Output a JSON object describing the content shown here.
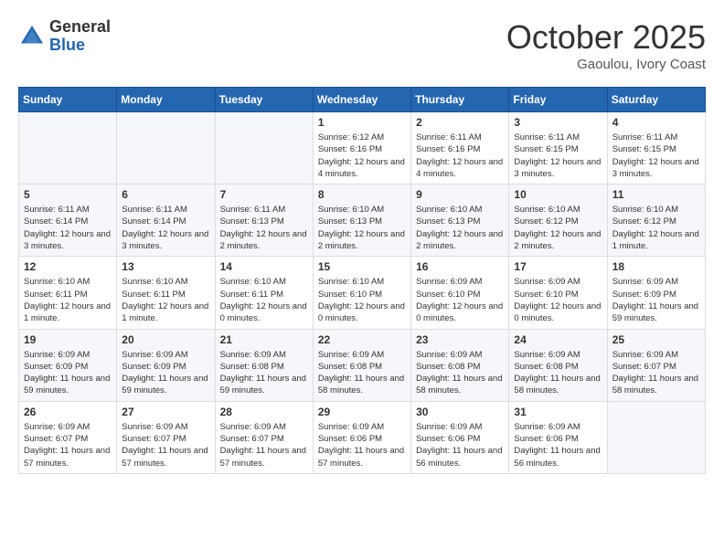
{
  "header": {
    "logo": {
      "general": "General",
      "blue": "Blue"
    },
    "title": "October 2025",
    "location": "Gaoulou, Ivory Coast"
  },
  "weekdays": [
    "Sunday",
    "Monday",
    "Tuesday",
    "Wednesday",
    "Thursday",
    "Friday",
    "Saturday"
  ],
  "weeks": [
    [
      {
        "day": "",
        "info": ""
      },
      {
        "day": "",
        "info": ""
      },
      {
        "day": "",
        "info": ""
      },
      {
        "day": "1",
        "info": "Sunrise: 6:12 AM\nSunset: 6:16 PM\nDaylight: 12 hours\nand 4 minutes."
      },
      {
        "day": "2",
        "info": "Sunrise: 6:11 AM\nSunset: 6:16 PM\nDaylight: 12 hours\nand 4 minutes."
      },
      {
        "day": "3",
        "info": "Sunrise: 6:11 AM\nSunset: 6:15 PM\nDaylight: 12 hours\nand 3 minutes."
      },
      {
        "day": "4",
        "info": "Sunrise: 6:11 AM\nSunset: 6:15 PM\nDaylight: 12 hours\nand 3 minutes."
      }
    ],
    [
      {
        "day": "5",
        "info": "Sunrise: 6:11 AM\nSunset: 6:14 PM\nDaylight: 12 hours\nand 3 minutes."
      },
      {
        "day": "6",
        "info": "Sunrise: 6:11 AM\nSunset: 6:14 PM\nDaylight: 12 hours\nand 3 minutes."
      },
      {
        "day": "7",
        "info": "Sunrise: 6:11 AM\nSunset: 6:13 PM\nDaylight: 12 hours\nand 2 minutes."
      },
      {
        "day": "8",
        "info": "Sunrise: 6:10 AM\nSunset: 6:13 PM\nDaylight: 12 hours\nand 2 minutes."
      },
      {
        "day": "9",
        "info": "Sunrise: 6:10 AM\nSunset: 6:13 PM\nDaylight: 12 hours\nand 2 minutes."
      },
      {
        "day": "10",
        "info": "Sunrise: 6:10 AM\nSunset: 6:12 PM\nDaylight: 12 hours\nand 2 minutes."
      },
      {
        "day": "11",
        "info": "Sunrise: 6:10 AM\nSunset: 6:12 PM\nDaylight: 12 hours\nand 1 minute."
      }
    ],
    [
      {
        "day": "12",
        "info": "Sunrise: 6:10 AM\nSunset: 6:11 PM\nDaylight: 12 hours\nand 1 minute."
      },
      {
        "day": "13",
        "info": "Sunrise: 6:10 AM\nSunset: 6:11 PM\nDaylight: 12 hours\nand 1 minute."
      },
      {
        "day": "14",
        "info": "Sunrise: 6:10 AM\nSunset: 6:11 PM\nDaylight: 12 hours\nand 0 minutes."
      },
      {
        "day": "15",
        "info": "Sunrise: 6:10 AM\nSunset: 6:10 PM\nDaylight: 12 hours\nand 0 minutes."
      },
      {
        "day": "16",
        "info": "Sunrise: 6:09 AM\nSunset: 6:10 PM\nDaylight: 12 hours\nand 0 minutes."
      },
      {
        "day": "17",
        "info": "Sunrise: 6:09 AM\nSunset: 6:10 PM\nDaylight: 12 hours\nand 0 minutes."
      },
      {
        "day": "18",
        "info": "Sunrise: 6:09 AM\nSunset: 6:09 PM\nDaylight: 11 hours\nand 59 minutes."
      }
    ],
    [
      {
        "day": "19",
        "info": "Sunrise: 6:09 AM\nSunset: 6:09 PM\nDaylight: 11 hours\nand 59 minutes."
      },
      {
        "day": "20",
        "info": "Sunrise: 6:09 AM\nSunset: 6:09 PM\nDaylight: 11 hours\nand 59 minutes."
      },
      {
        "day": "21",
        "info": "Sunrise: 6:09 AM\nSunset: 6:08 PM\nDaylight: 11 hours\nand 59 minutes."
      },
      {
        "day": "22",
        "info": "Sunrise: 6:09 AM\nSunset: 6:08 PM\nDaylight: 11 hours\nand 58 minutes."
      },
      {
        "day": "23",
        "info": "Sunrise: 6:09 AM\nSunset: 6:08 PM\nDaylight: 11 hours\nand 58 minutes."
      },
      {
        "day": "24",
        "info": "Sunrise: 6:09 AM\nSunset: 6:08 PM\nDaylight: 11 hours\nand 58 minutes."
      },
      {
        "day": "25",
        "info": "Sunrise: 6:09 AM\nSunset: 6:07 PM\nDaylight: 11 hours\nand 58 minutes."
      }
    ],
    [
      {
        "day": "26",
        "info": "Sunrise: 6:09 AM\nSunset: 6:07 PM\nDaylight: 11 hours\nand 57 minutes."
      },
      {
        "day": "27",
        "info": "Sunrise: 6:09 AM\nSunset: 6:07 PM\nDaylight: 11 hours\nand 57 minutes."
      },
      {
        "day": "28",
        "info": "Sunrise: 6:09 AM\nSunset: 6:07 PM\nDaylight: 11 hours\nand 57 minutes."
      },
      {
        "day": "29",
        "info": "Sunrise: 6:09 AM\nSunset: 6:06 PM\nDaylight: 11 hours\nand 57 minutes."
      },
      {
        "day": "30",
        "info": "Sunrise: 6:09 AM\nSunset: 6:06 PM\nDaylight: 11 hours\nand 56 minutes."
      },
      {
        "day": "31",
        "info": "Sunrise: 6:09 AM\nSunset: 6:06 PM\nDaylight: 11 hours\nand 56 minutes."
      },
      {
        "day": "",
        "info": ""
      }
    ]
  ]
}
